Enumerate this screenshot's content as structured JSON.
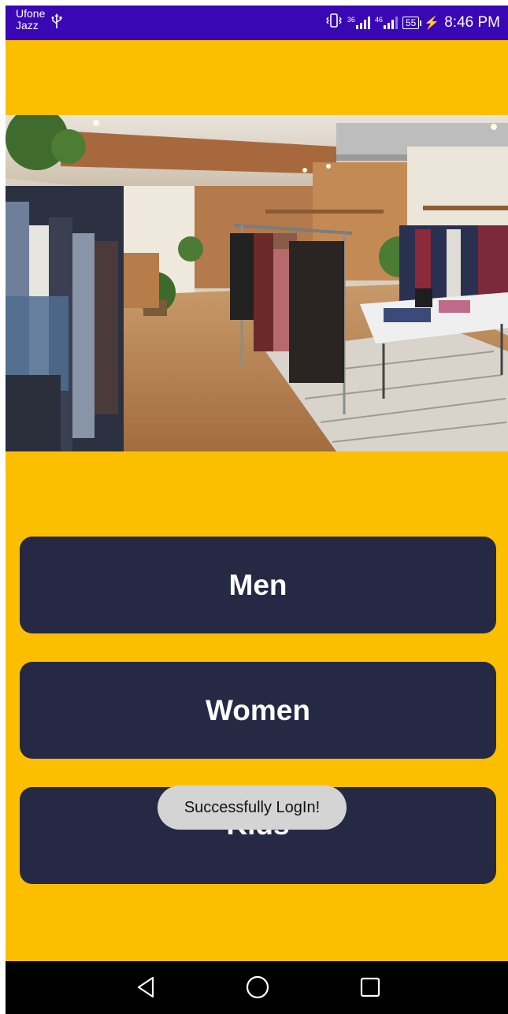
{
  "status_bar": {
    "carrier_line1": "Ufone",
    "carrier_line2": "Jazz",
    "net1": "36",
    "net2": "46",
    "battery": "55",
    "time": "8:46 PM",
    "background_color": "#3a07b4"
  },
  "theme": {
    "background": "#fcbf00",
    "button_color": "#262944"
  },
  "hero": {
    "icon": "store-interior-photo"
  },
  "categories": [
    {
      "label": "Men"
    },
    {
      "label": "Women"
    },
    {
      "label": "Kids"
    }
  ],
  "toast": {
    "message": "Successfully LogIn!"
  },
  "nav": {
    "back_icon": "back-triangle-icon",
    "home_icon": "home-circle-icon",
    "recents_icon": "recents-square-icon"
  }
}
